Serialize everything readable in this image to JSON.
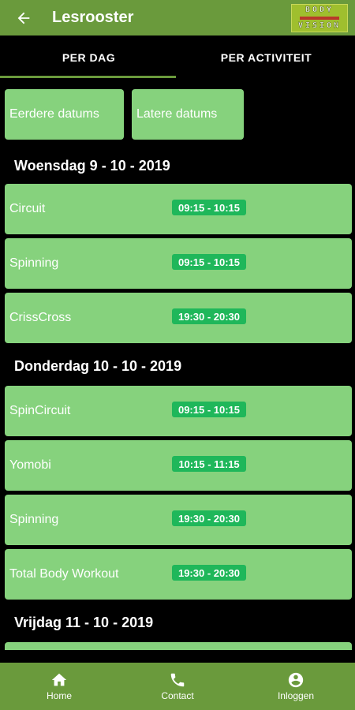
{
  "appbar": {
    "title": "Lesrooster",
    "back_icon": "arrow-left-icon",
    "logo_text_top": "BODY",
    "logo_text_bottom": "VISION"
  },
  "tabs": [
    {
      "label": "PER DAG",
      "active": true
    },
    {
      "label": "PER ACTIVITEIT",
      "active": false
    }
  ],
  "date_nav": {
    "previous_label": "Eerdere datums",
    "next_label": "Latere datums"
  },
  "days": [
    {
      "date": "Woensdag 9 - 10 - 2019",
      "sessions": [
        {
          "name": "Circuit",
          "time": "09:15 - 10:15"
        },
        {
          "name": "Spinning",
          "time": "09:15 - 10:15"
        },
        {
          "name": "CrissCross",
          "time": "19:30 - 20:30"
        }
      ]
    },
    {
      "date": "Donderdag 10 - 10 - 2019",
      "sessions": [
        {
          "name": "SpinCircuit",
          "time": "09:15 - 10:15"
        },
        {
          "name": "Yomobi",
          "time": "10:15 - 11:15"
        },
        {
          "name": "Spinning",
          "time": "19:30 - 20:30"
        },
        {
          "name": "Total Body Workout",
          "time": "19:30 - 20:30"
        }
      ]
    },
    {
      "date": "Vrijdag 11 - 10 - 2019",
      "sessions": []
    }
  ],
  "bottom_nav": [
    {
      "label": "Home",
      "icon": "home-icon"
    },
    {
      "label": "Contact",
      "icon": "phone-icon"
    },
    {
      "label": "Inloggen",
      "icon": "account-circle-icon"
    }
  ],
  "colors": {
    "primary": "#6a9a3c",
    "card": "#86d27d",
    "time_badge": "#1fb75a",
    "background": "#000000"
  }
}
